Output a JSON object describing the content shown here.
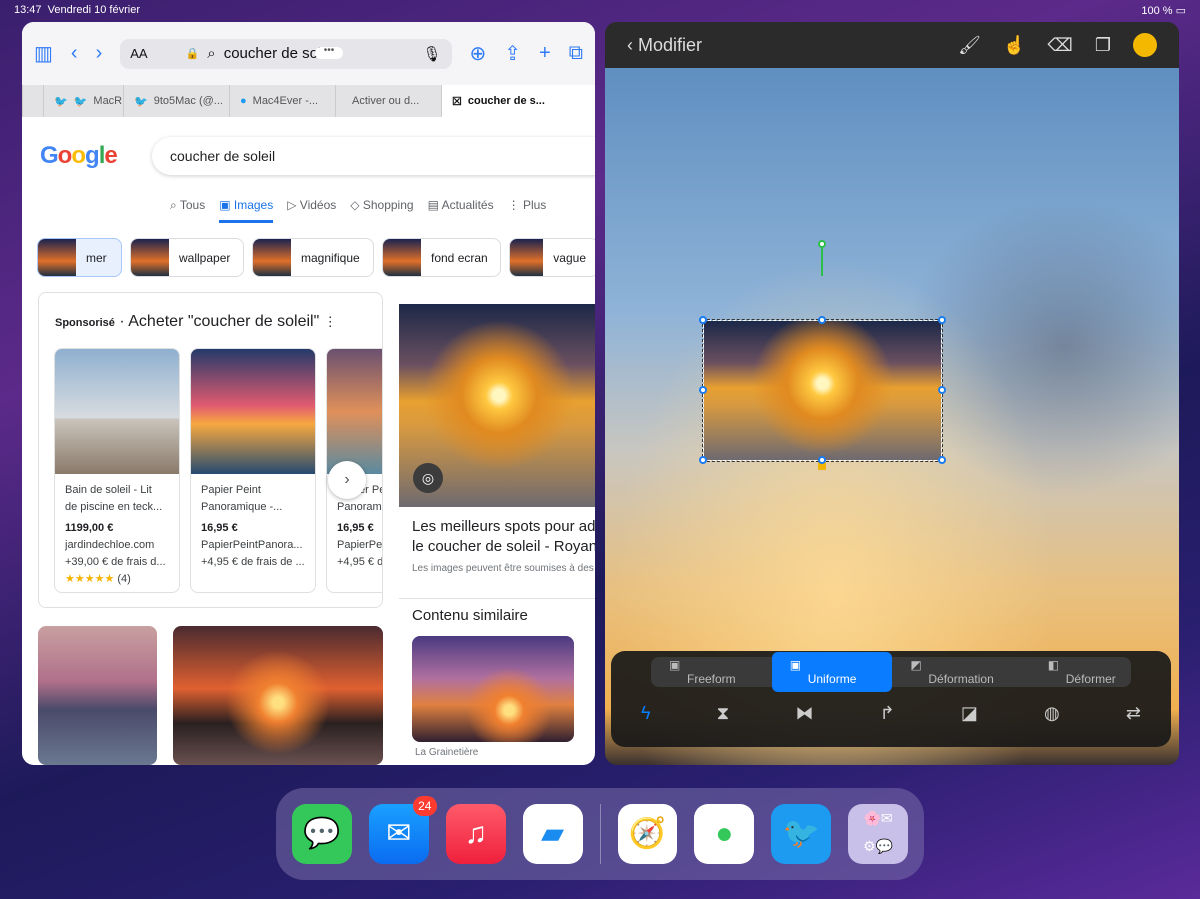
{
  "status": {
    "time": "13:47",
    "date": "Vendredi 10 février",
    "battery": "100 %"
  },
  "safari": {
    "aa": "AA",
    "address": "coucher de soleil",
    "tabs": [
      {
        "label": ""
      },
      {
        "label": "MacR"
      },
      {
        "label": "9to5Mac (@..."
      },
      {
        "label": "Mac4Ever -..."
      },
      {
        "label": "Activer ou d..."
      },
      {
        "label": "coucher de s..."
      }
    ]
  },
  "google": {
    "logo": "Google",
    "query": "coucher de soleil",
    "nav": [
      "Tous",
      "Images",
      "Vidéos",
      "Shopping",
      "Actualités",
      "Plus"
    ],
    "chips": [
      "mer",
      "wallpaper",
      "magnifique",
      "fond ecran",
      "vague"
    ],
    "sponsored": {
      "label": "Sponsorisé",
      "title": "· Acheter \"coucher de soleil\"",
      "products": [
        {
          "title1": "Bain de soleil - Lit",
          "title2": "de piscine en teck...",
          "price": "1199,00 €",
          "seller": "jardindechloe.com",
          "shipping": "+39,00 € de frais d...",
          "rating": "★★★★★",
          "reviews": "(4)"
        },
        {
          "title1": "Papier Peint",
          "title2": "Panoramique -...",
          "price": "16,95 €",
          "seller": "PapierPeintPanora...",
          "shipping": "+4,95 € de frais de ..."
        },
        {
          "title1": "Papier Pe",
          "title2": "Panoram",
          "price": "16,95 €",
          "seller": "PapierPe",
          "shipping": "+4,95 € d"
        }
      ]
    },
    "result": {
      "title1": "Les meilleurs spots pour ad",
      "title2": "le coucher de soleil - Royan",
      "note": "Les images peuvent être soumises à des"
    },
    "similar": "Contenu similaire",
    "source": "La Grainetière"
  },
  "procreate": {
    "back": "Modifier",
    "color": "#f5b800",
    "modes": [
      "Freeform",
      "Uniforme",
      "Déformation",
      "Déformer"
    ],
    "active_mode": "Uniforme"
  },
  "dock": {
    "mail_badge": "24"
  }
}
